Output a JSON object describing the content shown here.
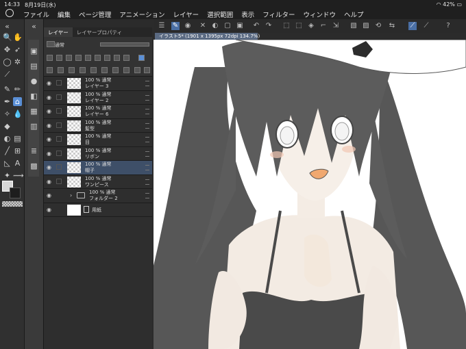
{
  "status": {
    "time": "14:33",
    "date": "8月19日(水)",
    "battery": "42%"
  },
  "menu": [
    "ファイル",
    "編集",
    "ページ管理",
    "アニメーション",
    "レイヤー",
    "選択範囲",
    "表示",
    "フィルター",
    "ウィンドウ",
    "ヘルプ"
  ],
  "layer_panel": {
    "tab_layer": "レイヤー",
    "tab_property": "レイヤープロパティ",
    "blend_mode": "通常",
    "layers": [
      {
        "line1": "100 % 通常",
        "line2": "レイヤー 3"
      },
      {
        "line1": "100 % 通常",
        "line2": "レイヤー 2"
      },
      {
        "line1": "100 % 通常",
        "line2": "レイヤー 6"
      },
      {
        "line1": "100 % 通常",
        "line2": "髪型"
      },
      {
        "line1": "100 % 通常",
        "line2": "目"
      },
      {
        "line1": "100 % 通常",
        "line2": "リボン"
      },
      {
        "line1": "100 % 通常",
        "line2": "帽子"
      },
      {
        "line1": "100 % 通常",
        "line2": "ワンピース"
      },
      {
        "line1": "100 % 通常",
        "line2": "フォルダー 2"
      },
      {
        "line1": "",
        "line2": "用紙"
      }
    ]
  },
  "canvas": {
    "tab_title": "イラスト5* (1901 x 1395px 72dpi 134.7%)"
  },
  "colors": {
    "accent": "#4a6fa5",
    "selection": "#3e4f68"
  }
}
